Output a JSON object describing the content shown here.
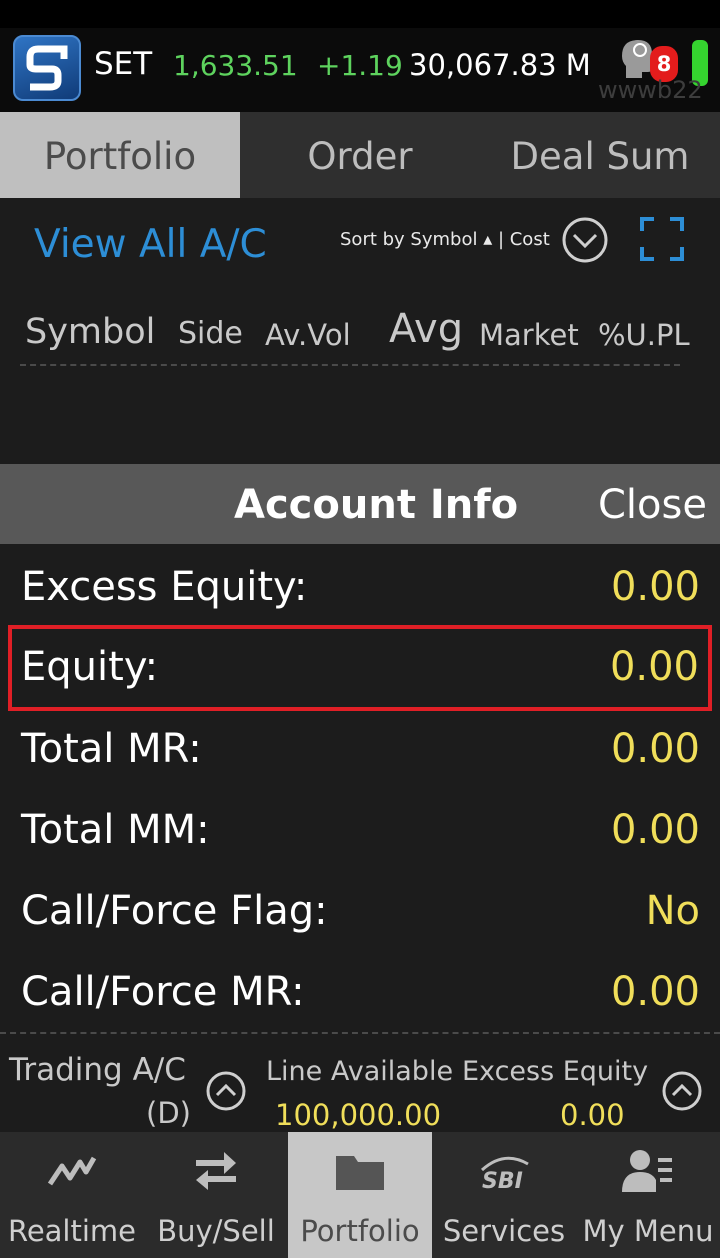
{
  "ticker": {
    "name": "SET",
    "index": "1,633.51",
    "change": "+1.19",
    "volume": "30,067.83 M",
    "notification_count": "8",
    "watermark": "wwwb22",
    "up_color": "#5ed35e"
  },
  "tabs": [
    {
      "label": "Portfolio",
      "active": true
    },
    {
      "label": "Order",
      "active": false
    },
    {
      "label": "Deal Sum",
      "active": false
    }
  ],
  "portfolio": {
    "view_all": "View All A/C",
    "sort_by": "Sort by Symbol ▴ | Cost",
    "columns": {
      "symbol": "Symbol",
      "side": "Side",
      "av_vol": "Av.Vol",
      "avg": "Avg",
      "market": "Market",
      "upl": "%U.PL"
    }
  },
  "account_info": {
    "title": "Account Info",
    "close_label": "Close",
    "rows": [
      {
        "label": "Excess Equity:",
        "value": "0.00"
      },
      {
        "label": "Equity:",
        "value": "0.00"
      },
      {
        "label": "Total MR:",
        "value": "0.00"
      },
      {
        "label": "Total MM:",
        "value": "0.00"
      },
      {
        "label": "Call/Force Flag:",
        "value": "No"
      },
      {
        "label": "Call/Force MR:",
        "value": "0.00"
      }
    ],
    "value_color": "#f0de5a",
    "highlight_color": "#e01f26"
  },
  "summary": {
    "trading_ac_label": "Trading A/C",
    "trading_ac_type": "(D)",
    "line_available_label": "Line Available",
    "line_available_value": "100,000.00",
    "excess_equity_label": "Excess Equity",
    "excess_equity_value": "0.00"
  },
  "bottom_nav": [
    {
      "label": "Realtime",
      "icon": "chart-line-icon",
      "active": false
    },
    {
      "label": "Buy/Sell",
      "icon": "swap-arrows-icon",
      "active": false
    },
    {
      "label": "Portfolio",
      "icon": "folder-icon",
      "active": true
    },
    {
      "label": "Services",
      "icon": "sbi-logo-icon",
      "active": false
    },
    {
      "label": "My Menu",
      "icon": "user-menu-icon",
      "active": false
    }
  ]
}
